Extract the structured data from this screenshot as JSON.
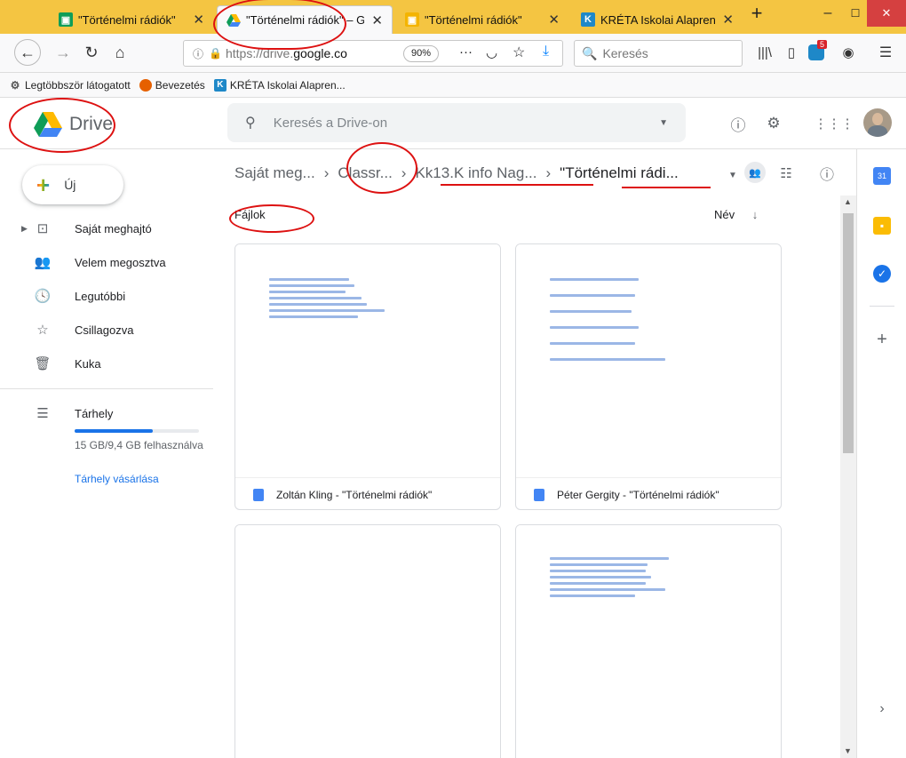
{
  "browser": {
    "tabs": [
      {
        "label": "\"Történelmi rádiók\"",
        "color": "#0f9d58"
      },
      {
        "label": "\"Történelmi rádiók\" – G",
        "color": "#4285f4"
      },
      {
        "label": "\"Történelmi rádiók\"",
        "color": "#f4b400"
      },
      {
        "label": "KRÉTA Iskolai Alaprend",
        "color": "#1e88c8"
      }
    ],
    "url_prefix": "https://drive.",
    "url_domain": "google.co",
    "zoom": "90%",
    "search_placeholder": "Keresés",
    "badge_count": "5",
    "bookmarks": [
      "Legtöbbször látogatott",
      "Bevezetés",
      "KRÉTA Iskolai Alapren..."
    ]
  },
  "drive": {
    "logo_text": "Drive",
    "search_placeholder": "Keresés a Drive-on",
    "new_label": "Új",
    "nav": [
      {
        "label": "Saját meghajtó"
      },
      {
        "label": "Velem megosztva"
      },
      {
        "label": "Legutóbbi"
      },
      {
        "label": "Csillagozva"
      },
      {
        "label": "Kuka"
      }
    ],
    "storage": {
      "label": "Tárhely",
      "used_text": "15 GB/9,4 GB felhasználva",
      "buy_label": "Tárhely vásárlása",
      "used_fraction": 0.63
    },
    "breadcrumb": [
      "Saját meg...",
      "Classr...",
      "Kk13.K info Nag...",
      "\"Történelmi rádi..."
    ],
    "section_title": "Fájlok",
    "sort_label": "Név",
    "files": [
      {
        "name": "Zoltán Kling - \"Történelmi rádiók\""
      },
      {
        "name": "Péter Gergity - \"Történelmi rádiók\""
      },
      {
        "name": ""
      },
      {
        "name": ""
      }
    ]
  },
  "colors": {
    "accent_blue": "#1a73e8",
    "annotation_red": "#dd1111",
    "titlebar": "#f4c542"
  }
}
